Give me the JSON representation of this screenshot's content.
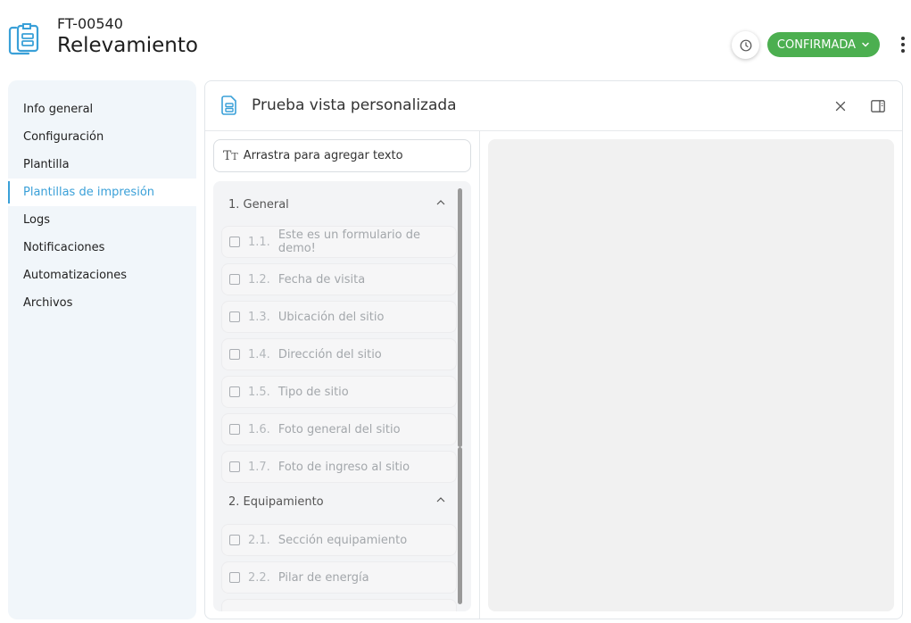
{
  "header": {
    "code": "FT-00540",
    "title": "Relevamiento",
    "status_label": "CONFIRMADA",
    "icons": {
      "document": "clipboard-document-icon",
      "history": "clock-icon",
      "status_chevron": "chevron-down-icon",
      "more": "more-vertical-icon"
    }
  },
  "sidebar": {
    "items": [
      {
        "label": "Info general"
      },
      {
        "label": "Configuración"
      },
      {
        "label": "Plantilla"
      },
      {
        "label": "Plantillas de impresión"
      },
      {
        "label": "Logs"
      },
      {
        "label": "Notificaciones"
      },
      {
        "label": "Automatizaciones"
      },
      {
        "label": "Archivos"
      }
    ],
    "active_index": 3
  },
  "panel": {
    "title": "Prueba vista personalizada",
    "text_drag_label": "Arrastra para agregar texto",
    "sections": [
      {
        "label": "1. General",
        "fields": [
          {
            "num": "1.1.",
            "label": "Este es un formulario de demo!"
          },
          {
            "num": "1.2.",
            "label": "Fecha de visita"
          },
          {
            "num": "1.3.",
            "label": "Ubicación del sitio"
          },
          {
            "num": "1.4.",
            "label": "Dirección del sitio"
          },
          {
            "num": "1.5.",
            "label": "Tipo de sitio"
          },
          {
            "num": "1.6.",
            "label": "Foto general del sitio"
          },
          {
            "num": "1.7.",
            "label": "Foto de ingreso al sitio"
          }
        ]
      },
      {
        "label": "2. Equipamiento",
        "fields": [
          {
            "num": "2.1.",
            "label": "Sección equipamiento"
          },
          {
            "num": "2.2.",
            "label": "Pilar de energía"
          }
        ]
      }
    ]
  },
  "colors": {
    "accent": "#3aa0d8",
    "status": "#4caf50",
    "sidebar_bg": "#f1f6fa",
    "preview_bg": "#f1f1f1"
  }
}
